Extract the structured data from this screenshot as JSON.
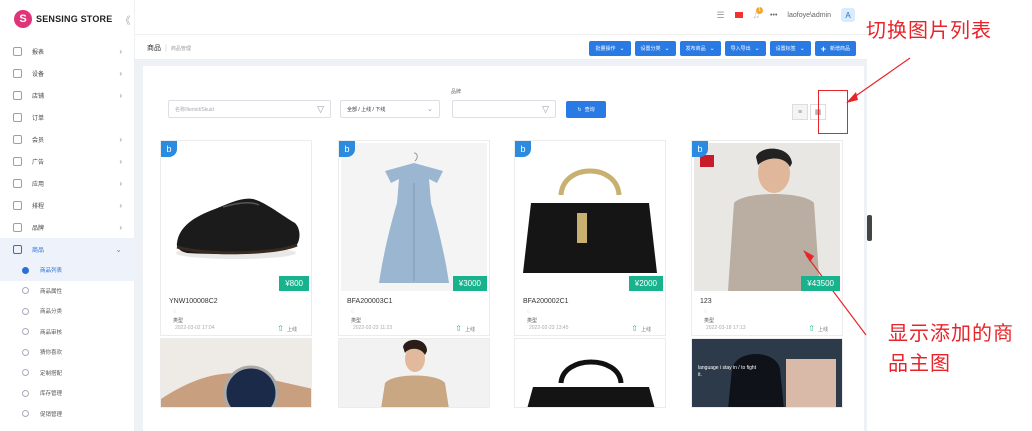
{
  "logo": {
    "mark": "S",
    "name": "SENSING STORE",
    "collapse": "《"
  },
  "sidebar": {
    "items": [
      {
        "label": "报表",
        "icon": "chart-icon",
        "arrow": "›"
      },
      {
        "label": "设备",
        "icon": "device-icon",
        "arrow": "›"
      },
      {
        "label": "店铺",
        "icon": "store-icon",
        "arrow": "›"
      },
      {
        "label": "订单",
        "icon": "order-icon",
        "arrow": ""
      },
      {
        "label": "会员",
        "icon": "member-icon",
        "arrow": "›"
      },
      {
        "label": "广告",
        "icon": "ad-icon",
        "arrow": "›"
      },
      {
        "label": "应用",
        "icon": "app-icon",
        "arrow": "›"
      },
      {
        "label": "排程",
        "icon": "schedule-icon",
        "arrow": "›"
      },
      {
        "label": "品牌",
        "icon": "brand-icon",
        "arrow": "›"
      },
      {
        "label": "商品",
        "icon": "goods-icon",
        "arrow": "⌄"
      }
    ],
    "sub_items": [
      {
        "label": "商品列表",
        "active": true
      },
      {
        "label": "商品属性"
      },
      {
        "label": "商品分类"
      },
      {
        "label": "商品审核"
      },
      {
        "label": "猜你喜欢"
      },
      {
        "label": "定制搭配"
      },
      {
        "label": "库存管理"
      },
      {
        "label": "促销管理"
      }
    ]
  },
  "topbar": {
    "more": "•••",
    "user": "laofoye\\admin",
    "avatar": "A",
    "badge": "1"
  },
  "breadcrumb": {
    "root": "商品",
    "current": "商品管理"
  },
  "actions": [
    {
      "label": "批量操作",
      "chevron": true
    },
    {
      "label": "设置分类",
      "chevron": true
    },
    {
      "label": "发布商品",
      "chevron": true
    },
    {
      "label": "导入导出",
      "chevron": true
    },
    {
      "label": "设置标签",
      "chevron": true
    },
    {
      "label": "新增商品",
      "plus": "+"
    }
  ],
  "filters": {
    "brand_label": "品牌",
    "search_placeholder": "名称/Itemid/Skuid",
    "status_value": "全部 / 上线 / 下线",
    "query_label": "查询"
  },
  "cards": [
    {
      "badge": "b",
      "price": "¥800",
      "name": "YNW100008C2",
      "tag": "◌",
      "type": "类型",
      "date": "2022-03-02 17:04",
      "status": "上线",
      "image": "shoe"
    },
    {
      "badge": "b",
      "price": "¥3000",
      "name": "BFA200003C1",
      "tag": "◌",
      "type": "类型",
      "date": "2022-02-23 11:23",
      "status": "上线",
      "image": "dress"
    },
    {
      "badge": "b",
      "price": "¥2000",
      "name": "BFA200002C1",
      "tag": "◌",
      "type": "类型",
      "date": "2022-02-23 13:45",
      "status": "上线",
      "image": "handbag"
    },
    {
      "badge": "b",
      "price": "¥43500",
      "name": "123",
      "tag": "◌",
      "type": "类型",
      "date": "2022-03-18 17:13",
      "status": "上线",
      "image": "shirt-man"
    }
  ],
  "cards_row2": [
    {
      "badge": "b",
      "image": "watch"
    },
    {
      "badge": "b",
      "image": "trench-woman"
    },
    {
      "badge": "b",
      "image": "black-bag"
    },
    {
      "badge": "b",
      "image": "backpack",
      "overlay": "language i stay in / to fight it."
    }
  ],
  "annotations": {
    "toggle": "切换图片列表",
    "main_image_1": "显示添加的商",
    "main_image_2": "品主图"
  },
  "colors": {
    "accent": "#2a7ae4",
    "price": "#18b28c",
    "annotation": "#e8242b"
  }
}
